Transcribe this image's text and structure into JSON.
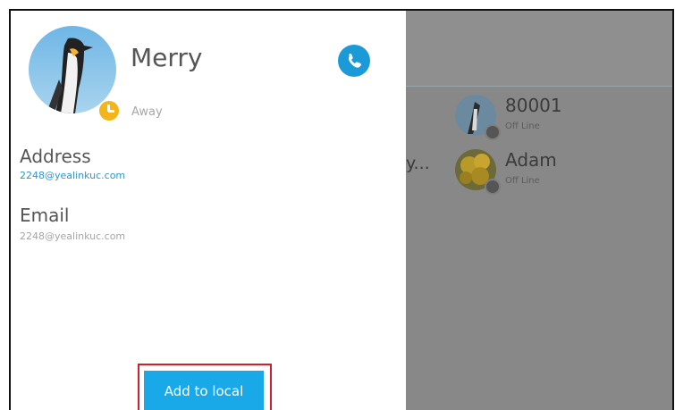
{
  "contact_detail": {
    "name": "Merry",
    "presence": "Away",
    "address_label": "Address",
    "address_value": "2248@yealinkuc.com",
    "email_label": "Email",
    "email_value": "2248@yealinkuc.com",
    "add_button_label": "Add to local"
  },
  "background_list": {
    "truncated_text": "y...",
    "contacts": [
      {
        "name": "80001",
        "status": "Off Line"
      },
      {
        "name": "Adam",
        "status": "Off Line"
      }
    ]
  },
  "colors": {
    "accent": "#19a8e8",
    "away": "#f4b51a",
    "highlight": "#d01f2d"
  }
}
